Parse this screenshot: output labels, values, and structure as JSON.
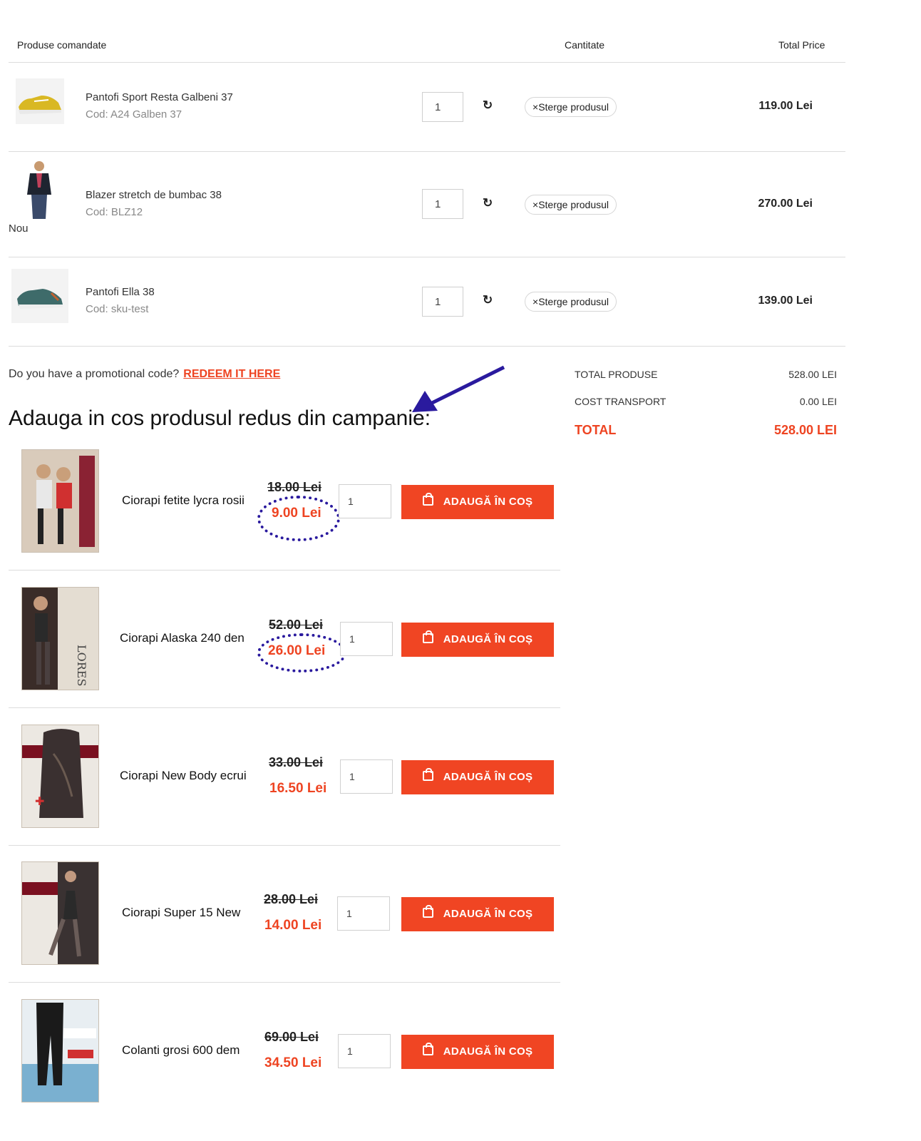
{
  "table_header": {
    "products": "Produse comandate",
    "quantity": "Cantitate",
    "total_price": "Total Price"
  },
  "cart_items": [
    {
      "name": "Pantofi Sport Resta Galbeni 37",
      "code": "Cod: A24 Galben 37",
      "qty": "1",
      "remove_label": "Sterge produsul",
      "total": "119.00 Lei",
      "badge": ""
    },
    {
      "name": "Blazer stretch de bumbac 38",
      "code": "Cod: BLZ12",
      "qty": "1",
      "remove_label": "Sterge produsul",
      "total": "270.00 Lei",
      "badge": "Nou"
    },
    {
      "name": "Pantofi Ella 38",
      "code": "Cod: sku-test",
      "qty": "1",
      "remove_label": "Sterge produsul",
      "total": "139.00 Lei",
      "badge": ""
    }
  ],
  "promo": {
    "question": "Do you have a promotional code?",
    "link": "REDEEM IT HERE"
  },
  "summary": {
    "products_label": "TOTAL PRODUSE",
    "products_value": "528.00 LEI",
    "transport_label": "COST TRANSPORT",
    "transport_value": "0.00 LEI",
    "total_label": "TOTAL",
    "total_value": "528.00 LEI"
  },
  "campaign": {
    "title": "Adauga in cos produsul redus din campanie:",
    "button_label": "ADAUGĂ ÎN COȘ",
    "items": [
      {
        "name": "Ciorapi fetite lycra rosii",
        "old_price": "18.00 Lei",
        "new_price": "9.00 Lei",
        "qty": "1"
      },
      {
        "name": "Ciorapi Alaska 240 den",
        "old_price": "52.00 Lei",
        "new_price": "26.00 Lei",
        "qty": "1"
      },
      {
        "name": "Ciorapi New Body ecrui",
        "old_price": "33.00 Lei",
        "new_price": "16.50 Lei",
        "qty": "1"
      },
      {
        "name": "Ciorapi Super 15 New",
        "old_price": "28.00 Lei",
        "new_price": "14.00 Lei",
        "qty": "1"
      },
      {
        "name": "Colanti grosi 600 dem",
        "old_price": "69.00 Lei",
        "new_price": "34.50 Lei",
        "qty": "1"
      }
    ]
  },
  "colors": {
    "accent": "#f04523",
    "annotation": "#2a1a9e"
  }
}
